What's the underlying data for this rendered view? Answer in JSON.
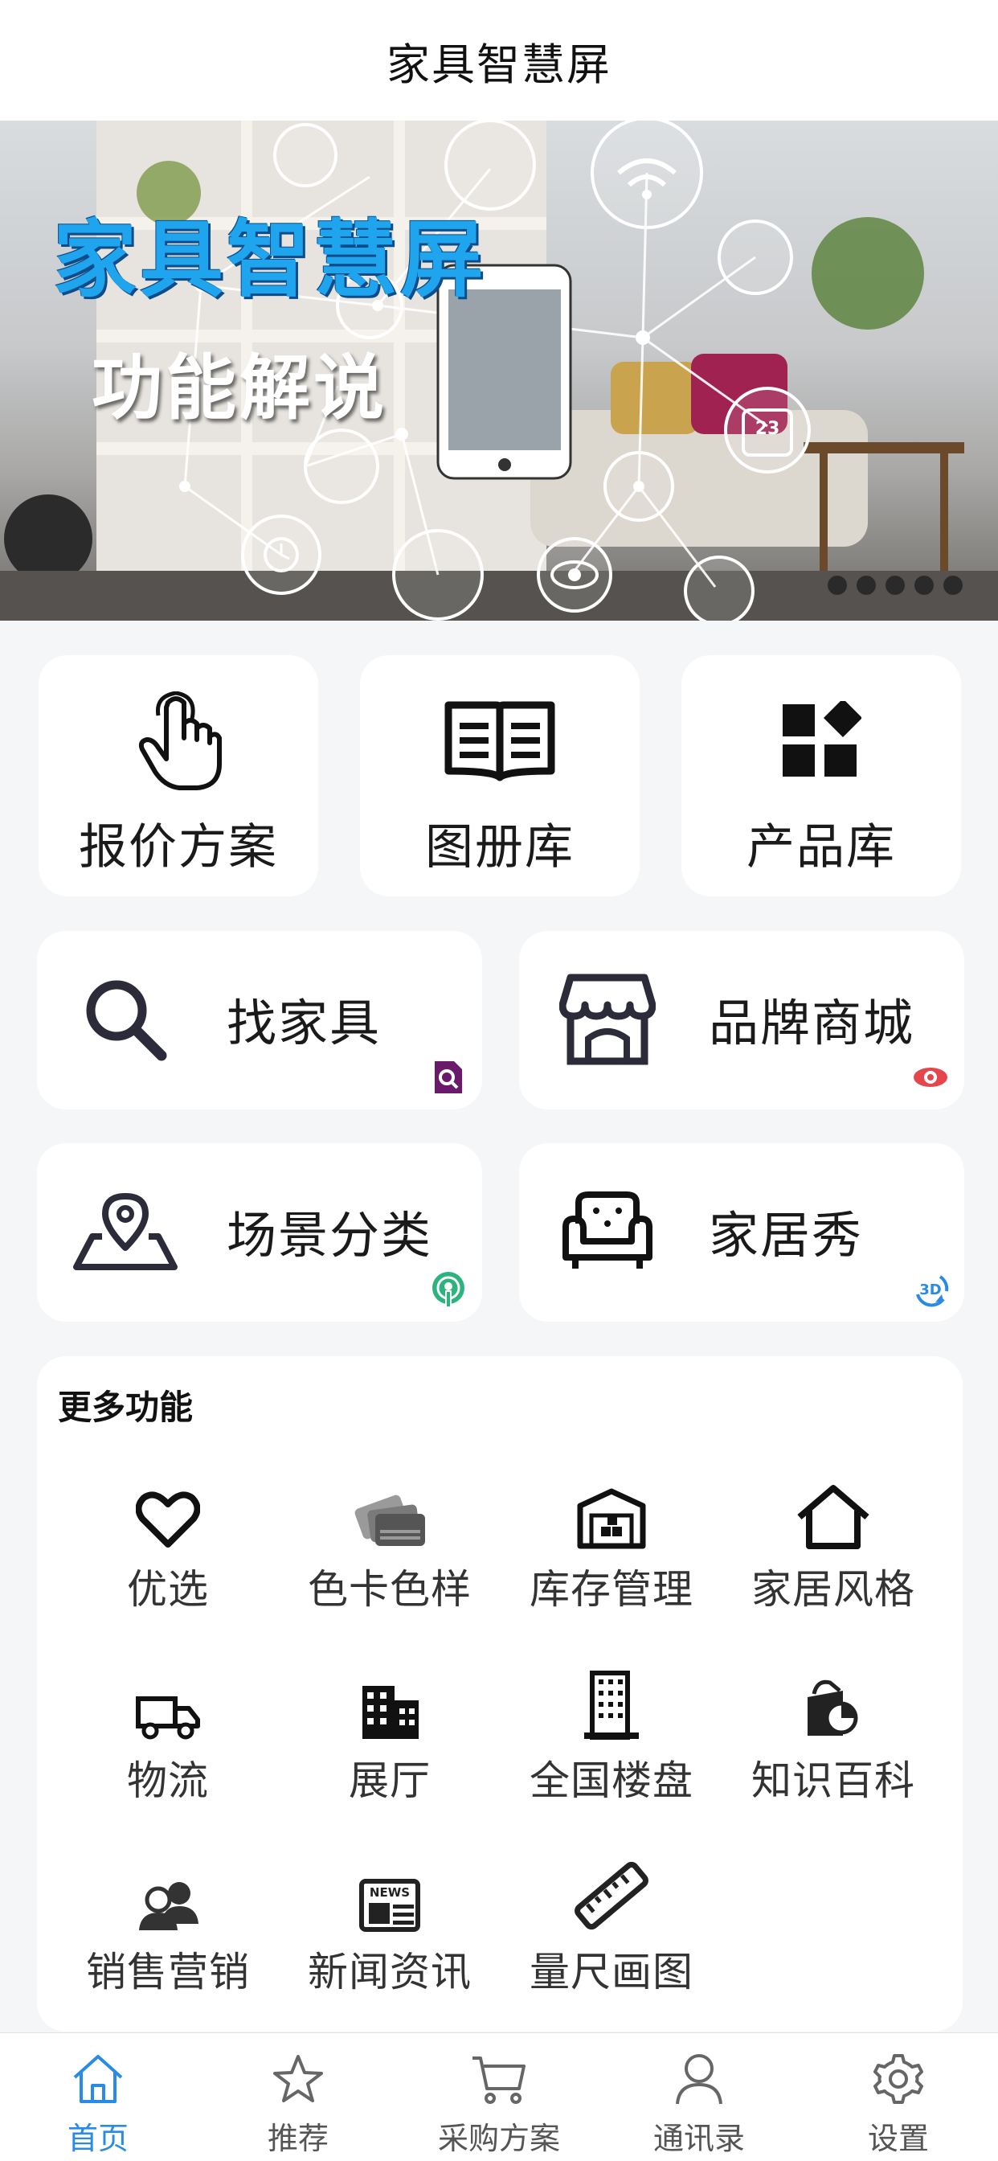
{
  "header": {
    "title": "家具智慧屏"
  },
  "banner": {
    "headline": "家具智慧屏",
    "subline": "功能解说",
    "calendar_number": "23",
    "dots_count": 5
  },
  "top_cards": [
    {
      "label": "报价方案",
      "icon": "hand-pointer-icon"
    },
    {
      "label": "图册库",
      "icon": "open-book-icon"
    },
    {
      "label": "产品库",
      "icon": "app-grid-icon"
    }
  ],
  "wide_cards": [
    {
      "label": "找家具",
      "icon": "search-icon",
      "badge": "search-doc-badge-icon",
      "badge_color": "#6b1a6b"
    },
    {
      "label": "品牌商城",
      "icon": "storefront-icon",
      "badge": "eye-badge-icon",
      "badge_color": "#e4464b"
    },
    {
      "label": "场景分类",
      "icon": "map-pin-icon",
      "badge": "podcast-badge-icon",
      "badge_color": "#2db37e"
    },
    {
      "label": "家居秀",
      "icon": "armchair-icon",
      "badge": "3d-rotate-badge-icon",
      "badge_color": "#2a8be6",
      "badge_text": "3D"
    }
  ],
  "more": {
    "title": "更多功能",
    "items": [
      {
        "label": "优选",
        "icon": "heart-icon"
      },
      {
        "label": "色卡色样",
        "icon": "color-cards-icon"
      },
      {
        "label": "库存管理",
        "icon": "warehouse-icon"
      },
      {
        "label": "家居风格",
        "icon": "house-icon"
      },
      {
        "label": "物流",
        "icon": "truck-icon"
      },
      {
        "label": "展厅",
        "icon": "office-building-icon"
      },
      {
        "label": "全国楼盘",
        "icon": "tower-building-icon"
      },
      {
        "label": "知识百科",
        "icon": "knowledge-bag-icon"
      },
      {
        "label": "销售营销",
        "icon": "people-icon"
      },
      {
        "label": "新闻资讯",
        "icon": "news-icon",
        "icon_text": "NEWS"
      },
      {
        "label": "量尺画图",
        "icon": "ruler-icon"
      }
    ]
  },
  "tabbar": {
    "active_color": "#2a8be6",
    "items": [
      {
        "label": "首页",
        "icon": "home-icon",
        "active": true
      },
      {
        "label": "推荐",
        "icon": "star-icon",
        "active": false
      },
      {
        "label": "采购方案",
        "icon": "cart-icon",
        "active": false
      },
      {
        "label": "通讯录",
        "icon": "person-icon",
        "active": false
      },
      {
        "label": "设置",
        "icon": "gear-icon",
        "active": false
      }
    ]
  }
}
